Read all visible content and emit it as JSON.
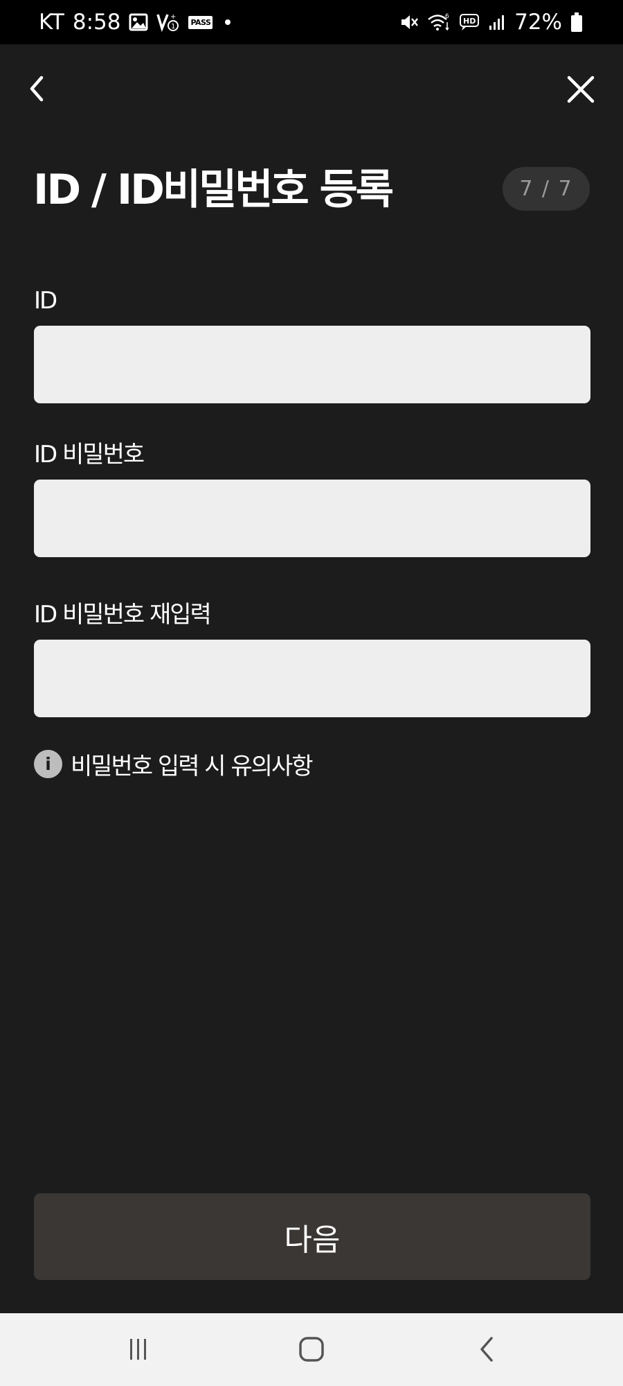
{
  "status_bar": {
    "carrier": "KT",
    "time": "8:58",
    "pass_label": "PASS",
    "battery": "72%",
    "icons": [
      "image-icon",
      "vpn-icon",
      "pass-icon",
      "dot-icon",
      "mute-icon",
      "wifi-icon",
      "hd-icon",
      "signal-icon",
      "battery-icon"
    ]
  },
  "header": {
    "back_icon": "chevron-left-icon",
    "close_icon": "close-icon"
  },
  "title": "ID / ID비밀번호 등록",
  "step": "7 / 7",
  "form": {
    "id_label": "ID",
    "id_value": "",
    "password_label": "ID 비밀번호",
    "password_value": "",
    "password_confirm_label": "ID 비밀번호 재입력",
    "password_confirm_value": ""
  },
  "notice": {
    "icon": "info-icon",
    "icon_glyph": "i",
    "text": "비밀번호 입력 시 유의사항"
  },
  "next_button": "다음",
  "nav_bar": {
    "icons": [
      "recent-apps-icon",
      "home-icon",
      "back-icon"
    ]
  },
  "colors": {
    "background": "#1c1c1c",
    "input_background": "#eeeeee",
    "button_background": "#3b3735",
    "badge_background": "#333333",
    "nav_background": "#f2f2f2"
  }
}
